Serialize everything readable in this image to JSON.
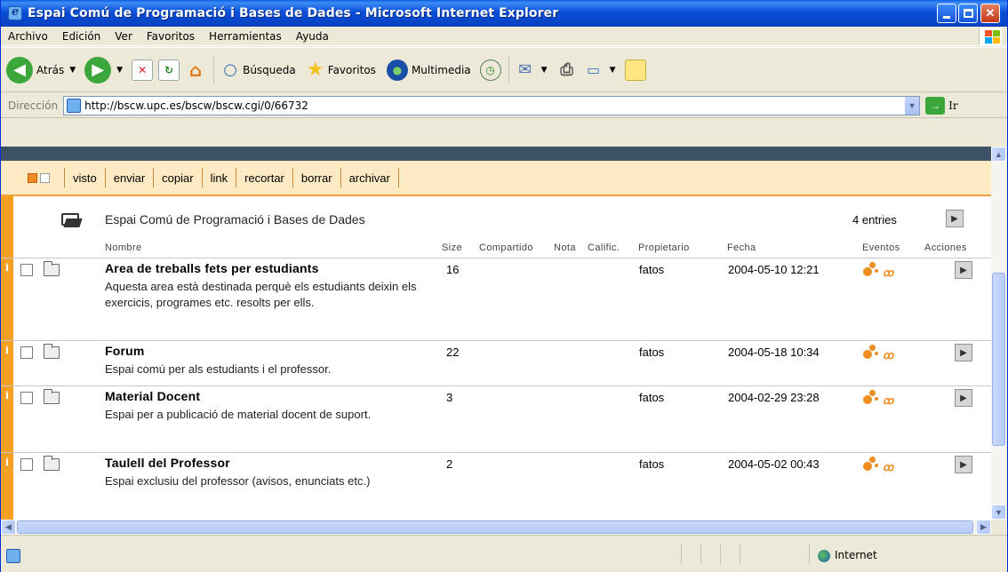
{
  "window": {
    "title": "Espai Comú de Programació i Bases de Dades - Microsoft Internet Explorer"
  },
  "menubar": [
    "Archivo",
    "Edición",
    "Ver",
    "Favoritos",
    "Herramientas",
    "Ayuda"
  ],
  "toolbar": {
    "back_label": "Atrás",
    "search_label": "Búsqueda",
    "favorites_label": "Favoritos",
    "media_label": "Multimedia"
  },
  "address": {
    "label": "Dirección",
    "url": "http://bscw.upc.es/bscw/bscw.cgi/0/66732",
    "go_label": "Ir"
  },
  "actions": [
    "visto",
    "enviar",
    "copiar",
    "link",
    "recortar",
    "borrar",
    "archivar"
  ],
  "folder": {
    "title": "Espai Comú de Programació i Bases de Dades",
    "entries": "4 entries"
  },
  "columns": {
    "nombre": "Nombre",
    "size": "Size",
    "compartido": "Compartido",
    "nota": "Nota",
    "calific": "Calific.",
    "propietario": "Propietario",
    "fecha": "Fecha",
    "eventos": "Eventos",
    "acciones": "Acciones"
  },
  "rows": [
    {
      "info": "i",
      "name": "Area de treballs fets per estudiants",
      "desc": "Aquesta area està destinada perquè els estudiants deixin els exercicis, programes etc. resolts per ells.",
      "size": "16",
      "owner": "fatos",
      "date": "2004-05-10 12:21"
    },
    {
      "info": "i",
      "name": "Forum",
      "desc": "Espai comú per als estudiants i el professor.",
      "size": "22",
      "owner": "fatos",
      "date": "2004-05-18 10:34"
    },
    {
      "info": "i",
      "name": "Material Docent",
      "desc": "Espai per a publicació de material docent de suport.",
      "size": "3",
      "owner": "fatos",
      "date": "2004-02-29 23:28"
    },
    {
      "info": "i",
      "name": "Taulell del Professor",
      "desc": "Espai exclusiu del professor (avisos, enunciats etc.)",
      "size": "2",
      "owner": "fatos",
      "date": "2004-05-02 00:43"
    }
  ],
  "status": {
    "zone": "Internet"
  },
  "colors": {
    "title_bar": "#0A4FD8",
    "accent_orange": "#F5A023",
    "action_bar_bg": "#FEEBC3",
    "top_strip": "#3E5266"
  }
}
